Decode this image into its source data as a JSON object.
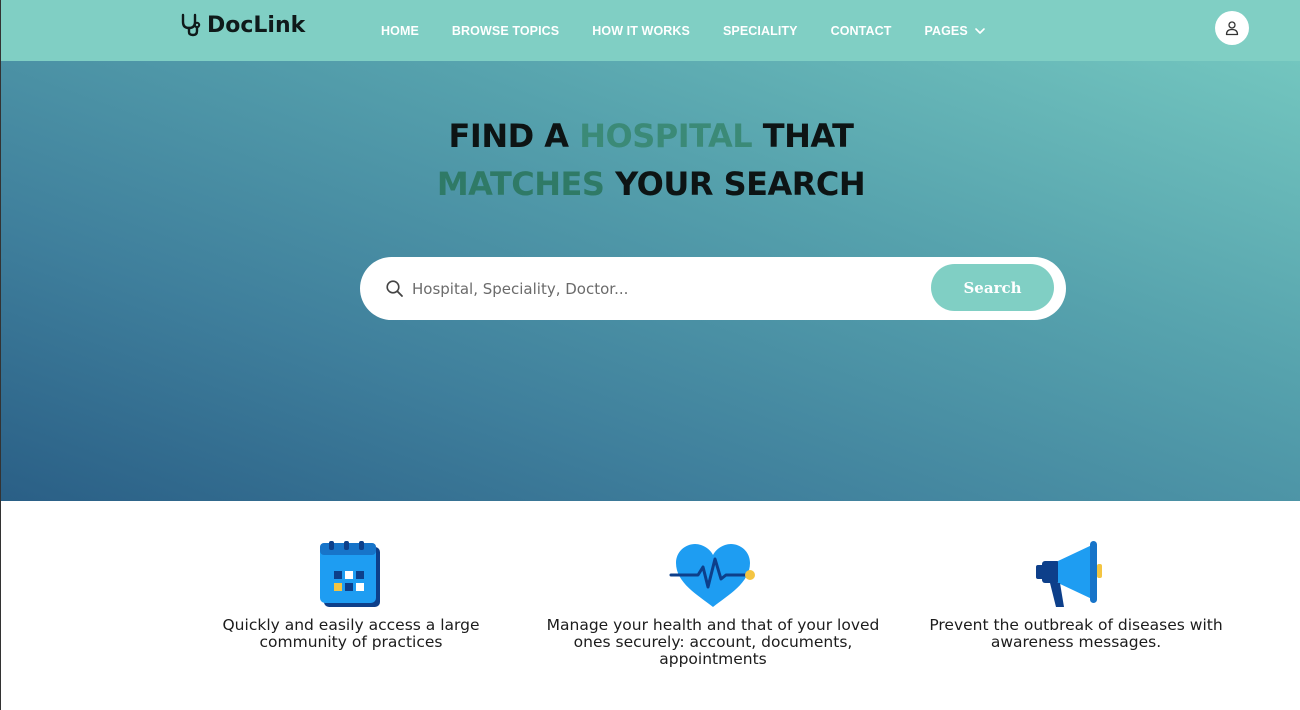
{
  "brand": {
    "name": "DocLink",
    "icon": "stethoscope-icon"
  },
  "nav": {
    "items": [
      {
        "label": "HOME"
      },
      {
        "label": "BROWSE TOPICS"
      },
      {
        "label": "HOW IT WORKS"
      },
      {
        "label": "SPECIALITY"
      },
      {
        "label": "CONTACT"
      },
      {
        "label": "PAGES",
        "icon": "chevron-down-icon"
      }
    ],
    "user_icon": "user-icon"
  },
  "hero": {
    "title_part1": "FIND A ",
    "title_accent1": "HOSPITAL",
    "title_part2": " THAT",
    "title_accent2": "MATCHES",
    "title_part3": " YOUR SEARCH",
    "search_placeholder": "Hospital, Speciality, Doctor...",
    "search_button": "Search"
  },
  "features": [
    {
      "icon": "calendar-icon",
      "text": "Quickly and easily access a large community of practices"
    },
    {
      "icon": "heart-pulse-icon",
      "text": "Manage your health and that of your loved ones securely: account, documents, appointments"
    },
    {
      "icon": "megaphone-icon",
      "text": "Prevent the outbreak of diseases with awareness messages."
    }
  ],
  "colors": {
    "navbar": "#80cfc4",
    "accent": "#3b8a77",
    "search_button": "#80cfc4",
    "icon_blue": "#1e9df2"
  }
}
